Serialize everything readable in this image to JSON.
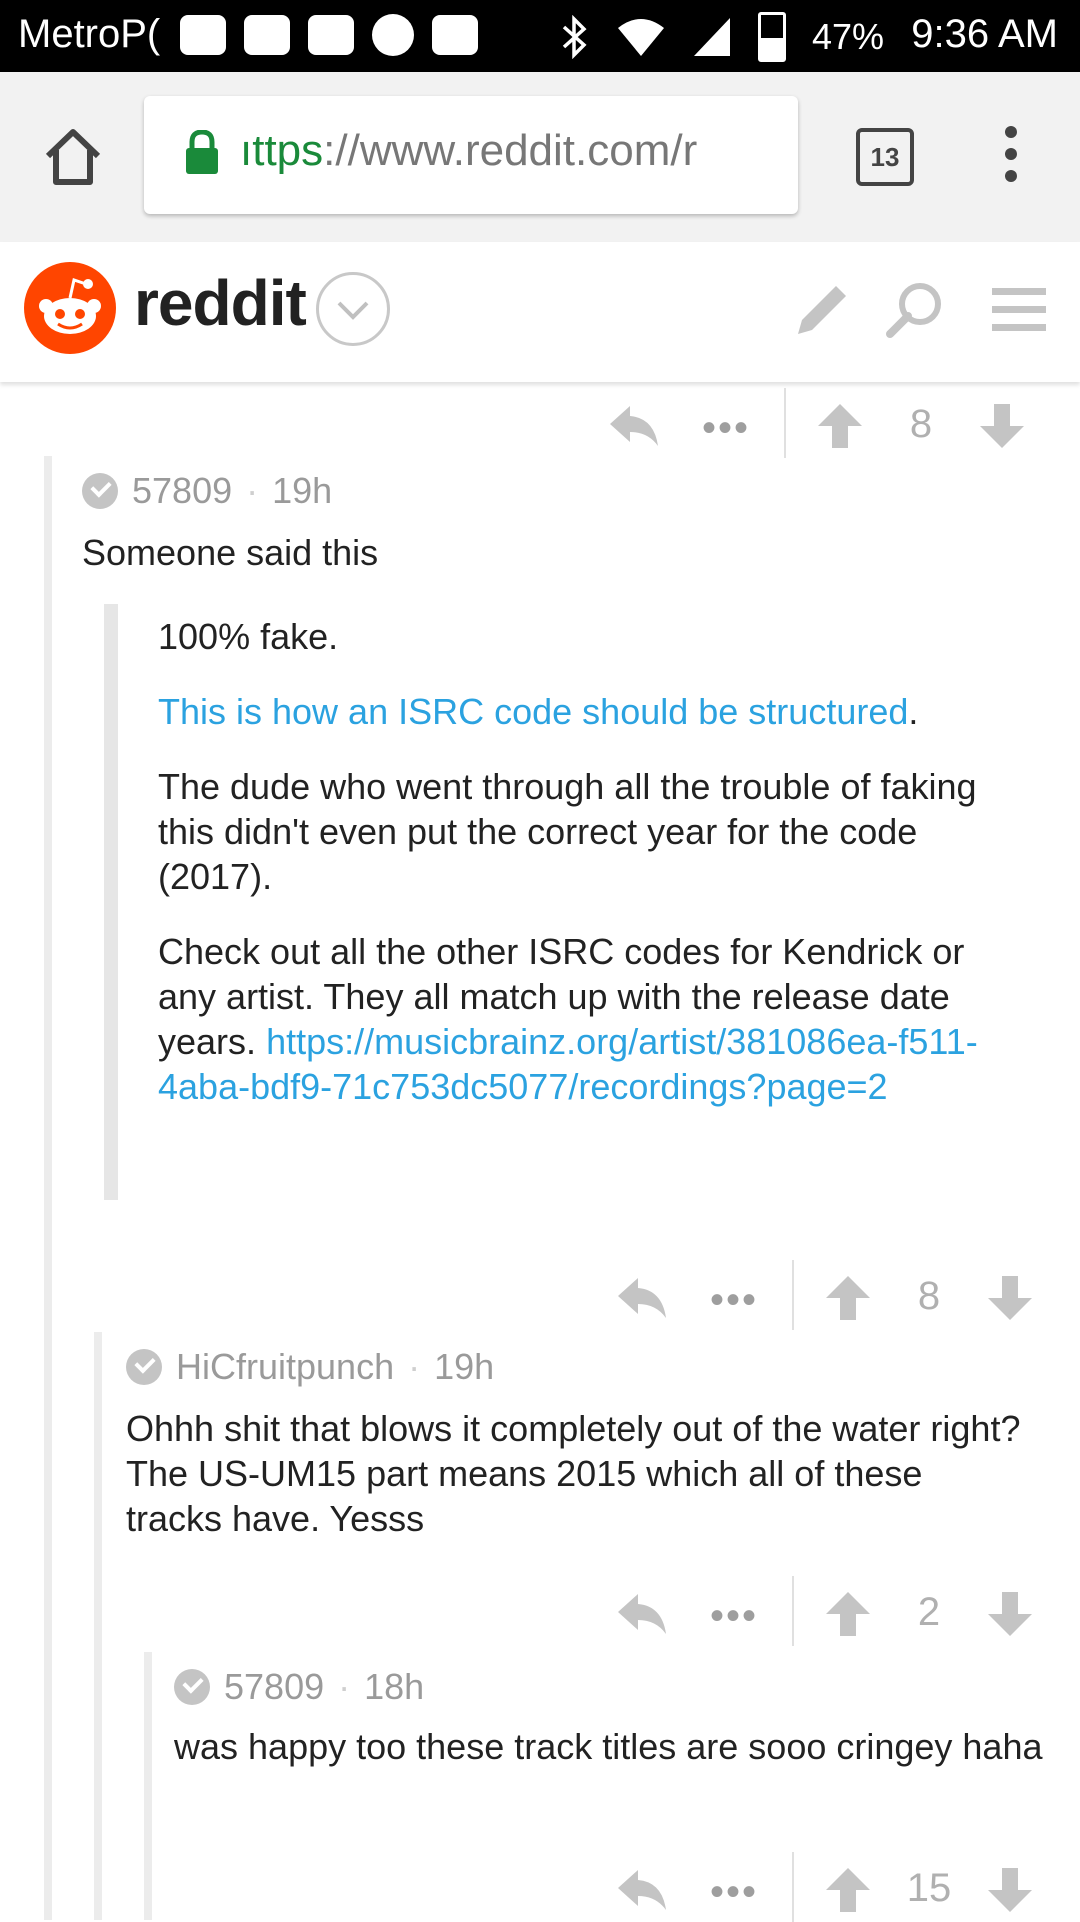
{
  "status_bar": {
    "carrier": "MetroP(",
    "battery_percent": "47%",
    "battery_level": 0.47,
    "time": "9:36 AM",
    "icons": [
      "messenger-icon",
      "youtube-icon",
      "youtube-icon",
      "shield-icon",
      "briefcase-icon",
      "bluetooth-icon",
      "wifi-icon",
      "signal-icon",
      "battery-icon"
    ]
  },
  "browser": {
    "url_scheme": "https",
    "url_prefix_visible": "ıttps",
    "url_rest": "://www.reddit.com/r",
    "tab_count": "13"
  },
  "header": {
    "brand": "reddit"
  },
  "colors": {
    "reddit_orange": "#ff4500",
    "link_blue": "#2ba2e0",
    "secure_green": "#1a8a3a"
  },
  "thread": {
    "top_actions": {
      "score": "8"
    },
    "comments": [
      {
        "author": "57809",
        "age": "19h",
        "text": "Someone said this",
        "quote": {
          "p1": "100% fake.",
          "p2_link": "This is how an ISRC code should be structured",
          "p2_tail": ".",
          "p3": "The dude who went through all the trouble of faking this didn't even put the correct year for the code (2017).",
          "p4_text": "Check out all the other ISRC codes for Kendrick or any artist. They all match up with the release date years.",
          "p4_link": "https://musicbrainz.org/artist/381086ea-f511-4aba-bdf9-71c753dc5077/recordings?page=2"
        },
        "score": "8"
      },
      {
        "author": "HiCfruitpunch",
        "age": "19h",
        "text": "Ohhh shit that blows it completely out of the water right? The US-UM15 part means 2015 which all of these tracks have. Yesss",
        "score": "2"
      },
      {
        "author": "57809",
        "age": "18h",
        "text": "was happy too these track titles are sooo cringey haha",
        "score": "15"
      }
    ],
    "separator": "·",
    "more_glyph": "•••"
  }
}
